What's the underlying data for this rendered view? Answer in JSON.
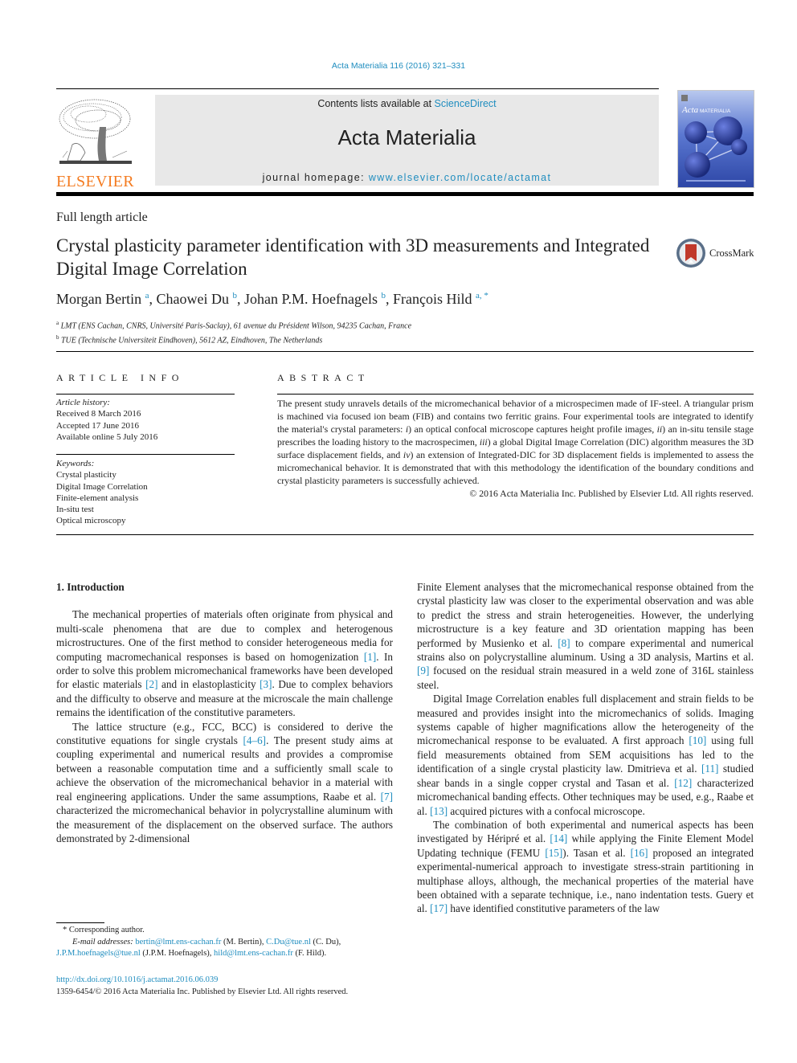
{
  "header": {
    "journal_ref": "Acta Materialia 116 (2016) 321–331",
    "contents_prefix": "Contents lists available at ",
    "contents_link": "ScienceDirect",
    "journal_title": "Acta Materialia",
    "homepage_prefix": "journal homepage: ",
    "homepage_link": "www.elsevier.com/locate/actamat",
    "publisher_name": "ELSEVIER",
    "cover_title_italic": "Acta",
    "cover_title_caps": "MATERIALIA",
    "colors": {
      "link": "#1f8dbf",
      "elsevier_orange": "#f47b20",
      "banner_bg": "#e8e8e8"
    }
  },
  "article": {
    "type": "Full length article",
    "title": "Crystal plasticity parameter identification with 3D measurements and Integrated Digital Image Correlation",
    "crossmark_label": "CrossMark",
    "authors": [
      {
        "name": "Morgan Bertin",
        "aff": "a"
      },
      {
        "name": "Chaowei Du",
        "aff": "b"
      },
      {
        "name": "Johan P.M. Hoefnagels",
        "aff": "b"
      },
      {
        "name": "François Hild",
        "aff": "a, *"
      }
    ],
    "affiliations": [
      {
        "key": "a",
        "text": "LMT (ENS Cachan, CNRS, Université Paris-Saclay), 61 avenue du Président Wilson, 94235 Cachan, France"
      },
      {
        "key": "b",
        "text": "TUE (Technische Universiteit Eindhoven), 5612 AZ, Eindhoven, The Netherlands"
      }
    ]
  },
  "article_info": {
    "heading": "ARTICLE INFO",
    "history_label": "Article history:",
    "history": [
      "Received 8 March 2016",
      "Accepted 17 June 2016",
      "Available online 5 July 2016"
    ],
    "keywords_label": "Keywords:",
    "keywords": [
      "Crystal plasticity",
      "Digital Image Correlation",
      "Finite-element analysis",
      "In-situ test",
      "Optical microscopy"
    ]
  },
  "abstract": {
    "heading": "ABSTRACT",
    "p1": "The present study unravels details of the micromechanical behavior of a microspecimen made of IF-steel. A triangular prism is machined via focused ion beam (FIB) and contains two ferritic grains. Four experimental tools are integrated to identify the material's crystal parameters: ",
    "i": "i",
    "p2": ") an optical confocal microscope captures height profile images, ",
    "ii": "ii",
    "p3": ") an in-situ tensile stage prescribes the loading history to the macrospecimen, ",
    "iii": "iii",
    "p4": ") a global Digital Image Correlation (DIC) algorithm measures the 3D surface displacement fields, and ",
    "iv": "iv",
    "p5": ") an extension of Integrated-DIC for 3D displacement fields is implemented to assess the micromechanical behavior. It is demonstrated that with this methodology the identification of the boundary conditions and crystal plasticity parameters is successfully achieved.",
    "copyright": "© 2016 Acta Materialia Inc. Published by Elsevier Ltd. All rights reserved."
  },
  "body": {
    "section_heading": "1.  Introduction",
    "left": {
      "p1a": "The mechanical properties of materials often originate from physical and multi-scale phenomena that are due to complex and heterogenous microstructures. One of the first method to consider heterogeneous media for computing macromechanical responses is based on homogenization ",
      "r1": "[1]",
      "p1b": ". In order to solve this problem micromechanical frameworks have been developed for elastic materials ",
      "r2": "[2]",
      "p1c": " and in elastoplasticity ",
      "r3": "[3]",
      "p1d": ". Due to complex behaviors and the difficulty to observe and measure at the microscale the main challenge remains the identification of the constitutive parameters.",
      "p2a": "The lattice structure (e.g., FCC, BCC) is considered to derive the constitutive equations for single crystals ",
      "r4": "[4–6]",
      "p2b": ". The present study aims at coupling experimental and numerical results and provides a compromise between a reasonable computation time and a sufficiently small scale to achieve the observation of the micromechanical behavior in a material with real engineering applications. Under the same assumptions, Raabe et al. ",
      "r7": "[7]",
      "p2c": " characterized the micromechanical behavior in polycrystalline aluminum with the measurement of the displacement on the observed surface. The authors demonstrated by 2-dimensional"
    },
    "right": {
      "p1a": "Finite Element analyses that the micromechanical response obtained from the crystal plasticity law was closer to the experimental observation and was able to predict the stress and strain heterogeneities. However, the underlying microstructure is a key feature and 3D orientation mapping has been performed by Musienko et al. ",
      "r8": "[8]",
      "p1b": " to compare experimental and numerical strains also on polycrystalline aluminum. Using a 3D analysis, Martins et al. ",
      "r9": "[9]",
      "p1c": " focused on the residual strain measured in a weld zone of 316L stainless steel.",
      "p2a": "Digital Image Correlation enables full displacement and strain fields to be measured and provides insight into the micromechanics of solids. Imaging systems capable of higher magnifications allow the heterogeneity of the micromechanical response to be evaluated. A first approach ",
      "r10": "[10]",
      "p2b": " using full field measurements obtained from SEM acquisitions has led to the identification of a single crystal plasticity law. Dmitrieva et al. ",
      "r11": "[11]",
      "p2c": " studied shear bands in a single copper crystal and Tasan et al. ",
      "r12": "[12]",
      "p2d": " characterized micromechanical banding effects. Other techniques may be used, e.g., Raabe et al. ",
      "r13": "[13]",
      "p2e": " acquired pictures with a confocal microscope.",
      "p3a": "The combination of both experimental and numerical aspects has been investigated by Héripré et al. ",
      "r14": "[14]",
      "p3b": " while applying the Finite Element Model Updating technique (FEMU ",
      "r15": "[15]",
      "p3c": "). Tasan et al. ",
      "r16": "[16]",
      "p3d": " proposed an integrated experimental-numerical approach to investigate stress-strain partitioning in multiphase alloys, although, the mechanical properties of the material have been obtained with a separate technique, i.e., nano indentation tests. Guery et al. ",
      "r17": "[17]",
      "p3e": " have identified constitutive parameters of the law"
    }
  },
  "footnotes": {
    "corresponding": "* Corresponding author.",
    "email_label": "E-mail addresses:",
    "emails": [
      {
        "addr": "bertin@lmt.ens-cachan.fr",
        "who": " (M. Bertin), "
      },
      {
        "addr": "C.Du@tue.nl",
        "who": " (C. Du), "
      },
      {
        "addr": "J.P.M.hoefnagels@tue.nl",
        "who": " (J.P.M. Hoefnagels), "
      },
      {
        "addr": "hild@lmt.ens-cachan.fr",
        "who": " (F. Hild)."
      }
    ],
    "doi": "http://dx.doi.org/10.1016/j.actamat.2016.06.039",
    "issn_line": "1359-6454/© 2016 Acta Materialia Inc. Published by Elsevier Ltd. All rights reserved."
  }
}
